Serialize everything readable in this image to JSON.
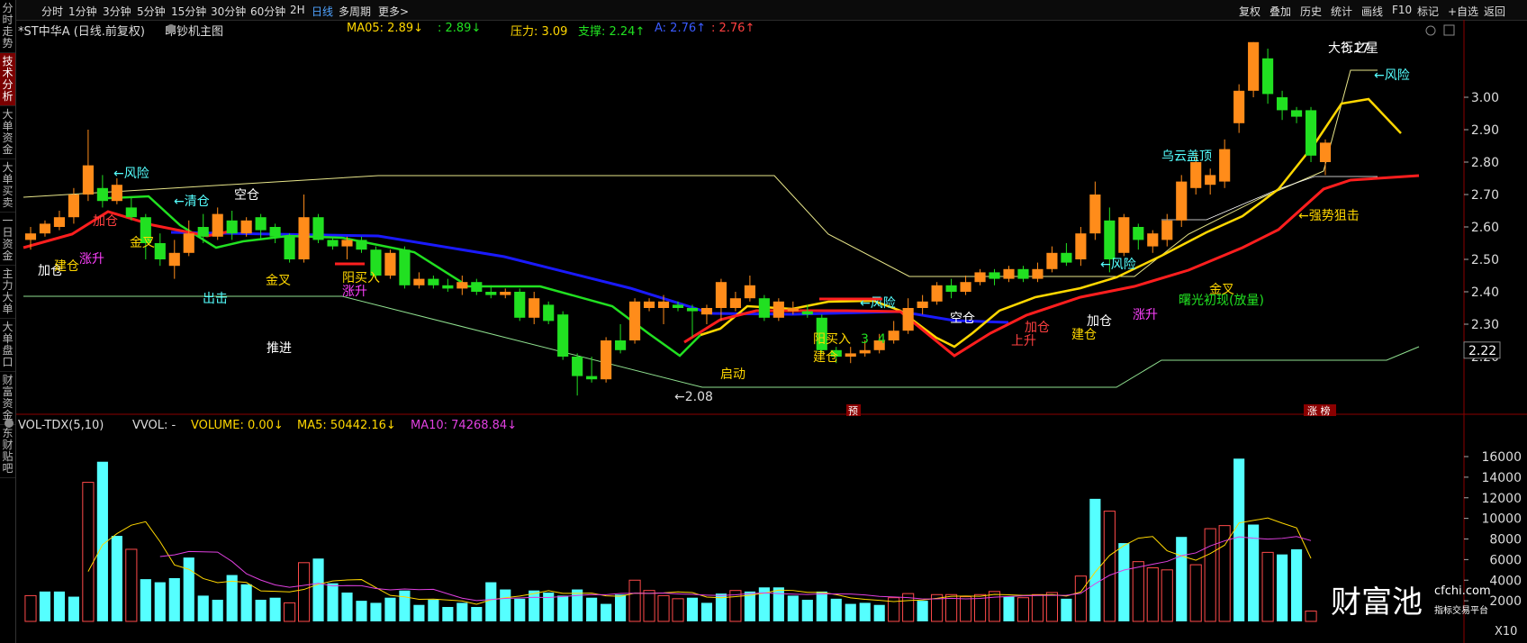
{
  "sidebar": {
    "items": [
      {
        "label": "分时走势",
        "active": false
      },
      {
        "label": "技术分析",
        "active": true
      },
      {
        "label": "大单资金",
        "active": false
      },
      {
        "label": "大单买卖",
        "active": false
      },
      {
        "label": "一日资金",
        "active": false
      },
      {
        "label": "主力大单",
        "active": false
      },
      {
        "label": "大单盘口",
        "active": false
      },
      {
        "label": "财富资金",
        "active": false
      },
      {
        "label": "东财贴吧",
        "active": false
      }
    ]
  },
  "toolbar": {
    "periods": [
      "分时",
      "1分钟",
      "3分钟",
      "5分钟",
      "15分钟",
      "30分钟",
      "60分钟",
      "2H",
      "日线",
      "多周期",
      "更多>"
    ],
    "active_period": "日线",
    "right_buttons": [
      "复权",
      "叠加",
      "历史",
      "统计",
      "画线",
      "F10",
      "标记",
      "+自选",
      "返回"
    ]
  },
  "price_header": {
    "title": "*ST中华A (日线.前复权)",
    "indicator": "印钞机主图",
    "ma05": "MA05: 2.89↓",
    "ma05b": ": 2.89↓",
    "pressure": "压力: 3.09",
    "support": "支撑: 2.24↑",
    "a_val": "A: 2.76↑",
    "a_val2": ": 2.76↑"
  },
  "vol_header": {
    "name": "VOL-TDX(5,10)",
    "vvol": "VVOL: -",
    "volume": "VOLUME: 0.00↓",
    "ma5": "MA5: 50442.16↓",
    "ma10": "MA10: 74268.84↓"
  },
  "price_axis": {
    "ticks": [
      "3.00",
      "2.90",
      "2.80",
      "2.70",
      "2.60",
      "2.50",
      "2.40",
      "2.30",
      "2.20"
    ],
    "current": "2.22"
  },
  "vol_axis": {
    "ticks": [
      "16000",
      "14000",
      "12000",
      "10000",
      "8000",
      "6000",
      "4000",
      "2000"
    ],
    "unit": "X10"
  },
  "annotations": {
    "low": "←2.08",
    "high": "3.17",
    "yu": "预",
    "zhang": "涨 榜",
    "labels": [
      "加仓",
      "建仓",
      "涨升",
      "←风险",
      "加仓",
      "←清仓",
      "金叉",
      "空仓",
      "出击",
      "金叉",
      "推进",
      "阳买入",
      "涨升",
      "启动",
      "←风险",
      "阳买入",
      "3",
      "4",
      "建仓",
      "空仓",
      "加仓",
      "上升",
      "加仓",
      "建仓",
      "←风险",
      "涨升",
      "曙光初现(放量)",
      "金叉",
      "乌云盖顶",
      "←强势狙击",
      "←风险",
      "大行之星"
    ]
  },
  "watermark": {
    "brand": "财富池",
    "site": "cfchi.com",
    "sub": "指标交易平台"
  },
  "colors": {
    "up": "#ff8c1a",
    "down": "#21e021",
    "blue": "#1414ff",
    "ma_red": "#ff1e1e",
    "ma_blue": "#1a1aff",
    "vol_up": "#ff4a4a",
    "vol_down": "#55ffff"
  },
  "chart_data": {
    "type": "candlestick",
    "price_range": [
      2.08,
      3.17
    ],
    "candles": [
      {
        "o": 2.56,
        "c": 2.58,
        "h": 2.6,
        "l": 2.53
      },
      {
        "o": 2.58,
        "c": 2.61,
        "h": 2.62,
        "l": 2.57
      },
      {
        "o": 2.6,
        "c": 2.63,
        "h": 2.65,
        "l": 2.59
      },
      {
        "o": 2.63,
        "c": 2.7,
        "h": 2.72,
        "l": 2.61
      },
      {
        "o": 2.7,
        "c": 2.79,
        "h": 2.9,
        "l": 2.68
      },
      {
        "o": 2.72,
        "c": 2.68,
        "h": 2.76,
        "l": 2.66
      },
      {
        "o": 2.68,
        "c": 2.73,
        "h": 2.75,
        "l": 2.67
      },
      {
        "o": 2.66,
        "c": 2.63,
        "h": 2.69,
        "l": 2.62
      },
      {
        "o": 2.63,
        "c": 2.55,
        "h": 2.64,
        "l": 2.5
      },
      {
        "o": 2.55,
        "c": 2.5,
        "h": 2.58,
        "l": 2.48
      },
      {
        "o": 2.48,
        "c": 2.52,
        "h": 2.56,
        "l": 2.44
      },
      {
        "o": 2.52,
        "c": 2.58,
        "h": 2.62,
        "l": 2.51
      },
      {
        "o": 2.6,
        "c": 2.57,
        "h": 2.64,
        "l": 2.55
      },
      {
        "o": 2.57,
        "c": 2.64,
        "h": 2.66,
        "l": 2.56
      },
      {
        "o": 2.62,
        "c": 2.58,
        "h": 2.65,
        "l": 2.56
      },
      {
        "o": 2.58,
        "c": 2.62,
        "h": 2.63,
        "l": 2.57
      },
      {
        "o": 2.63,
        "c": 2.59,
        "h": 2.64,
        "l": 2.56
      },
      {
        "o": 2.6,
        "c": 2.57,
        "h": 2.61,
        "l": 2.55
      },
      {
        "o": 2.57,
        "c": 2.5,
        "h": 2.58,
        "l": 2.49
      },
      {
        "o": 2.5,
        "c": 2.63,
        "h": 2.7,
        "l": 2.49
      },
      {
        "o": 2.63,
        "c": 2.56,
        "h": 2.64,
        "l": 2.55
      },
      {
        "o": 2.56,
        "c": 2.54,
        "h": 2.57,
        "l": 2.53
      },
      {
        "o": 2.54,
        "c": 2.56,
        "h": 2.57,
        "l": 2.5
      },
      {
        "o": 2.56,
        "c": 2.53,
        "h": 2.57,
        "l": 2.52
      },
      {
        "o": 2.53,
        "c": 2.45,
        "h": 2.54,
        "l": 2.44
      },
      {
        "o": 2.45,
        "c": 2.52,
        "h": 2.53,
        "l": 2.44
      },
      {
        "o": 2.53,
        "c": 2.42,
        "h": 2.54,
        "l": 2.41
      },
      {
        "o": 2.42,
        "c": 2.44,
        "h": 2.46,
        "l": 2.41
      },
      {
        "o": 2.44,
        "c": 2.42,
        "h": 2.45,
        "l": 2.41
      },
      {
        "o": 2.42,
        "c": 2.41,
        "h": 2.44,
        "l": 2.4
      },
      {
        "o": 2.41,
        "c": 2.43,
        "h": 2.45,
        "l": 2.39
      },
      {
        "o": 2.43,
        "c": 2.4,
        "h": 2.44,
        "l": 2.39
      },
      {
        "o": 2.4,
        "c": 2.39,
        "h": 2.42,
        "l": 2.38
      },
      {
        "o": 2.39,
        "c": 2.4,
        "h": 2.41,
        "l": 2.38
      },
      {
        "o": 2.4,
        "c": 2.32,
        "h": 2.41,
        "l": 2.31
      },
      {
        "o": 2.32,
        "c": 2.38,
        "h": 2.4,
        "l": 2.3
      },
      {
        "o": 2.36,
        "c": 2.31,
        "h": 2.37,
        "l": 2.3
      },
      {
        "o": 2.33,
        "c": 2.2,
        "h": 2.34,
        "l": 2.19
      },
      {
        "o": 2.2,
        "c": 2.14,
        "h": 2.21,
        "l": 2.08
      },
      {
        "o": 2.14,
        "c": 2.13,
        "h": 2.2,
        "l": 2.12
      },
      {
        "o": 2.13,
        "c": 2.25,
        "h": 2.26,
        "l": 2.12
      },
      {
        "o": 2.25,
        "c": 2.22,
        "h": 2.3,
        "l": 2.21
      },
      {
        "o": 2.25,
        "c": 2.37,
        "h": 2.38,
        "l": 2.24
      },
      {
        "o": 2.35,
        "c": 2.37,
        "h": 2.38,
        "l": 2.34
      },
      {
        "o": 2.35,
        "c": 2.37,
        "h": 2.39,
        "l": 2.3
      },
      {
        "o": 2.36,
        "c": 2.35,
        "h": 2.37,
        "l": 2.34
      },
      {
        "o": 2.35,
        "c": 2.34,
        "h": 2.36,
        "l": 2.26
      },
      {
        "o": 2.33,
        "c": 2.35,
        "h": 2.36,
        "l": 2.3
      },
      {
        "o": 2.35,
        "c": 2.43,
        "h": 2.44,
        "l": 2.31
      },
      {
        "o": 2.35,
        "c": 2.38,
        "h": 2.4,
        "l": 2.34
      },
      {
        "o": 2.38,
        "c": 2.42,
        "h": 2.45,
        "l": 2.37
      },
      {
        "o": 2.38,
        "c": 2.32,
        "h": 2.39,
        "l": 2.31
      },
      {
        "o": 2.32,
        "c": 2.37,
        "h": 2.38,
        "l": 2.31
      },
      {
        "o": 2.34,
        "c": 2.35,
        "h": 2.37,
        "l": 2.33
      },
      {
        "o": 2.34,
        "c": 2.33,
        "h": 2.36,
        "l": 2.32
      },
      {
        "o": 2.32,
        "c": 2.22,
        "h": 2.33,
        "l": 2.21
      },
      {
        "o": 2.22,
        "c": 2.2,
        "h": 2.23,
        "l": 2.18
      },
      {
        "o": 2.2,
        "c": 2.21,
        "h": 2.23,
        "l": 2.18
      },
      {
        "o": 2.21,
        "c": 2.22,
        "h": 2.25,
        "l": 2.2
      },
      {
        "o": 2.22,
        "c": 2.25,
        "h": 2.27,
        "l": 2.21
      },
      {
        "o": 2.25,
        "c": 2.28,
        "h": 2.31,
        "l": 2.24
      },
      {
        "o": 2.28,
        "c": 2.35,
        "h": 2.38,
        "l": 2.27
      },
      {
        "o": 2.35,
        "c": 2.37,
        "h": 2.39,
        "l": 2.33
      },
      {
        "o": 2.37,
        "c": 2.42,
        "h": 2.43,
        "l": 2.36
      },
      {
        "o": 2.42,
        "c": 2.4,
        "h": 2.44,
        "l": 2.38
      },
      {
        "o": 2.4,
        "c": 2.43,
        "h": 2.45,
        "l": 2.39
      },
      {
        "o": 2.43,
        "c": 2.46,
        "h": 2.47,
        "l": 2.42
      },
      {
        "o": 2.46,
        "c": 2.44,
        "h": 2.47,
        "l": 2.42
      },
      {
        "o": 2.44,
        "c": 2.47,
        "h": 2.48,
        "l": 2.43
      },
      {
        "o": 2.47,
        "c": 2.44,
        "h": 2.48,
        "l": 2.43
      },
      {
        "o": 2.44,
        "c": 2.47,
        "h": 2.49,
        "l": 2.43
      },
      {
        "o": 2.47,
        "c": 2.52,
        "h": 2.54,
        "l": 2.46
      },
      {
        "o": 2.52,
        "c": 2.49,
        "h": 2.55,
        "l": 2.48
      },
      {
        "o": 2.5,
        "c": 2.58,
        "h": 2.6,
        "l": 2.48
      },
      {
        "o": 2.58,
        "c": 2.7,
        "h": 2.74,
        "l": 2.56
      },
      {
        "o": 2.62,
        "c": 2.5,
        "h": 2.66,
        "l": 2.46
      },
      {
        "o": 2.52,
        "c": 2.63,
        "h": 2.64,
        "l": 2.51
      },
      {
        "o": 2.6,
        "c": 2.56,
        "h": 2.61,
        "l": 2.53
      },
      {
        "o": 2.54,
        "c": 2.58,
        "h": 2.59,
        "l": 2.52
      },
      {
        "o": 2.56,
        "c": 2.62,
        "h": 2.64,
        "l": 2.54
      },
      {
        "o": 2.62,
        "c": 2.74,
        "h": 2.76,
        "l": 2.6
      },
      {
        "o": 2.72,
        "c": 2.8,
        "h": 2.83,
        "l": 2.7
      },
      {
        "o": 2.73,
        "c": 2.76,
        "h": 2.78,
        "l": 2.7
      },
      {
        "o": 2.74,
        "c": 2.84,
        "h": 2.87,
        "l": 2.72
      },
      {
        "o": 2.92,
        "c": 3.02,
        "h": 3.04,
        "l": 2.89
      },
      {
        "o": 3.02,
        "c": 3.17,
        "h": 3.17,
        "l": 3.0
      },
      {
        "o": 3.12,
        "c": 3.01,
        "h": 3.15,
        "l": 2.98
      },
      {
        "o": 3.0,
        "c": 2.96,
        "h": 3.02,
        "l": 2.93
      },
      {
        "o": 2.96,
        "c": 2.94,
        "h": 2.97,
        "l": 2.92
      },
      {
        "o": 2.96,
        "c": 2.82,
        "h": 2.97,
        "l": 2.8
      },
      {
        "o": 2.8,
        "c": 2.86,
        "h": 2.87,
        "l": 2.76
      }
    ],
    "volumes": [
      {
        "v": 2500,
        "up": true
      },
      {
        "v": 2900,
        "up": false
      },
      {
        "v": 2900,
        "up": false
      },
      {
        "v": 2400,
        "up": false
      },
      {
        "v": 13500,
        "up": true
      },
      {
        "v": 15500,
        "up": false
      },
      {
        "v": 8300,
        "up": false
      },
      {
        "v": 7000,
        "up": true
      },
      {
        "v": 4100,
        "up": false
      },
      {
        "v": 3800,
        "up": false
      },
      {
        "v": 4200,
        "up": false
      },
      {
        "v": 6200,
        "up": false
      },
      {
        "v": 2500,
        "up": false
      },
      {
        "v": 2100,
        "up": false
      },
      {
        "v": 4500,
        "up": false
      },
      {
        "v": 3600,
        "up": false
      },
      {
        "v": 2100,
        "up": false
      },
      {
        "v": 2300,
        "up": false
      },
      {
        "v": 1800,
        "up": true
      },
      {
        "v": 5700,
        "up": true
      },
      {
        "v": 6100,
        "up": false
      },
      {
        "v": 3700,
        "up": false
      },
      {
        "v": 2800,
        "up": false
      },
      {
        "v": 2000,
        "up": false
      },
      {
        "v": 1800,
        "up": false
      },
      {
        "v": 2300,
        "up": false
      },
      {
        "v": 3000,
        "up": false
      },
      {
        "v": 1600,
        "up": false
      },
      {
        "v": 2100,
        "up": false
      },
      {
        "v": 1400,
        "up": false
      },
      {
        "v": 1800,
        "up": false
      },
      {
        "v": 1400,
        "up": false
      },
      {
        "v": 3800,
        "up": false
      },
      {
        "v": 3100,
        "up": false
      },
      {
        "v": 2200,
        "up": false
      },
      {
        "v": 3000,
        "up": false
      },
      {
        "v": 2800,
        "up": false
      },
      {
        "v": 2500,
        "up": false
      },
      {
        "v": 3100,
        "up": false
      },
      {
        "v": 2300,
        "up": false
      },
      {
        "v": 1700,
        "up": false
      },
      {
        "v": 2600,
        "up": false
      },
      {
        "v": 4000,
        "up": true
      },
      {
        "v": 3000,
        "up": true
      },
      {
        "v": 2500,
        "up": true
      },
      {
        "v": 2200,
        "up": true
      },
      {
        "v": 2300,
        "up": false
      },
      {
        "v": 1800,
        "up": false
      },
      {
        "v": 2700,
        "up": false
      },
      {
        "v": 3000,
        "up": true
      },
      {
        "v": 2900,
        "up": false
      },
      {
        "v": 3300,
        "up": false
      },
      {
        "v": 3300,
        "up": false
      },
      {
        "v": 2500,
        "up": false
      },
      {
        "v": 2100,
        "up": false
      },
      {
        "v": 2900,
        "up": false
      },
      {
        "v": 2200,
        "up": false
      },
      {
        "v": 1700,
        "up": false
      },
      {
        "v": 1800,
        "up": false
      },
      {
        "v": 1600,
        "up": false
      },
      {
        "v": 2300,
        "up": true
      },
      {
        "v": 2700,
        "up": true
      },
      {
        "v": 2000,
        "up": false
      },
      {
        "v": 2600,
        "up": true
      },
      {
        "v": 2600,
        "up": true
      },
      {
        "v": 2400,
        "up": true
      },
      {
        "v": 2600,
        "up": true
      },
      {
        "v": 2900,
        "up": true
      },
      {
        "v": 2400,
        "up": false
      },
      {
        "v": 2300,
        "up": true
      },
      {
        "v": 2600,
        "up": true
      },
      {
        "v": 2800,
        "up": true
      },
      {
        "v": 2200,
        "up": false
      },
      {
        "v": 4400,
        "up": true
      },
      {
        "v": 11900,
        "up": false
      },
      {
        "v": 10700,
        "up": true
      },
      {
        "v": 7600,
        "up": false
      },
      {
        "v": 5800,
        "up": true
      },
      {
        "v": 5200,
        "up": true
      },
      {
        "v": 5000,
        "up": true
      },
      {
        "v": 8200,
        "up": false
      },
      {
        "v": 5500,
        "up": true
      },
      {
        "v": 9000,
        "up": true
      },
      {
        "v": 9300,
        "up": true
      },
      {
        "v": 15800,
        "up": false
      },
      {
        "v": 9400,
        "up": false
      },
      {
        "v": 6700,
        "up": true
      },
      {
        "v": 6500,
        "up": false
      },
      {
        "v": 7000,
        "up": false
      },
      {
        "v": 1000,
        "up": true
      }
    ],
    "vol_range": [
      0,
      17000
    ]
  }
}
